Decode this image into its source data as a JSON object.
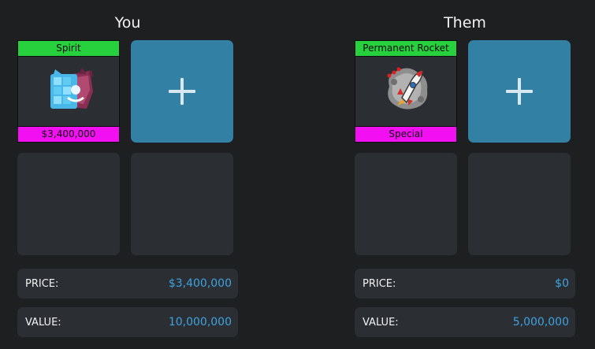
{
  "you": {
    "title": "You",
    "item": {
      "name": "Spirit",
      "subtitle": "$3,400,000",
      "name_color": "#27d13e",
      "subtitle_color": "#f20ff2",
      "icon": "spirit-fruit-icon"
    },
    "price_label": "PRICE:",
    "price_value": "$3,400,000",
    "value_label": "VALUE:",
    "value_value": "10,000,000"
  },
  "them": {
    "title": "Them",
    "item": {
      "name": "Permanent Rocket",
      "subtitle": "Special",
      "name_color": "#27d13e",
      "subtitle_color": "#f20ff2",
      "icon": "rocket-fruit-icon"
    },
    "price_label": "PRICE:",
    "price_value": "$0",
    "value_label": "VALUE:",
    "value_value": "5,000,000"
  },
  "colors": {
    "background": "#1e1f21",
    "slot": "#2b2e33",
    "add_button": "#3280a4",
    "value_text": "#3ea3e0"
  },
  "icons": {
    "add": "plus-icon"
  }
}
